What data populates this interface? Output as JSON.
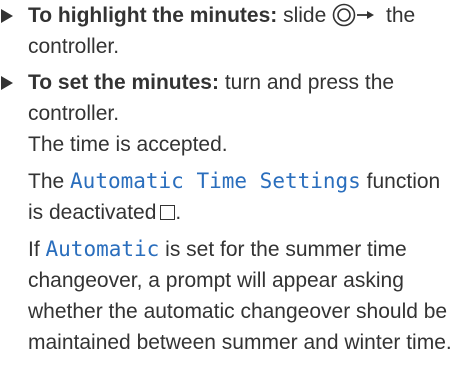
{
  "step1": {
    "bold": "To highlight the minutes:",
    "text_before_icon": "slide",
    "icon": "controller-slide-right-icon",
    "text_after_icon": "the controller."
  },
  "step2": {
    "bold": "To set the minutes:",
    "text": "turn and press the controller.",
    "result": "The time is accepted.",
    "para2": {
      "text_before": "The",
      "function_name": "Automatic Time Settings",
      "text_after": "function is deactivated",
      "checkbox_icon": "empty-checkbox-icon"
    },
    "para3": {
      "text_before": "If",
      "option_name": "Automatic",
      "text_after": "is set for the summer time changeover, a prompt will appear asking whether the automatic changeover should be maintained between summer and winter time."
    }
  },
  "colors": {
    "text": "#333333",
    "function_text": "#2a6ebd"
  }
}
